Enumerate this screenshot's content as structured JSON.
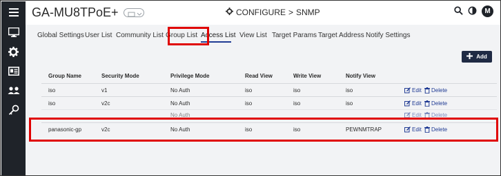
{
  "sidebar": {
    "items": [
      {
        "icon": "menu-icon"
      },
      {
        "icon": "monitor-icon"
      },
      {
        "icon": "gear-icon"
      },
      {
        "icon": "id-card-icon"
      },
      {
        "icon": "users-icon"
      },
      {
        "icon": "key-icon"
      }
    ]
  },
  "header": {
    "device_name": "GA-MU8TPoE+",
    "section": "CONFIGURE",
    "separator": ">",
    "page": "SNMP",
    "avatar_letter": "M"
  },
  "tabs": [
    {
      "label": "Global Settings"
    },
    {
      "label": "User List"
    },
    {
      "label": "Community List"
    },
    {
      "label": "Group List"
    },
    {
      "label": "Access List"
    },
    {
      "label": "View List"
    },
    {
      "label": "Target Params"
    },
    {
      "label": "Target Address"
    },
    {
      "label": "Notify Settings"
    }
  ],
  "active_tab": "Access List",
  "add_button": {
    "label": "Add"
  },
  "table": {
    "columns": [
      "Group Name",
      "Security Mode",
      "Privilege Mode",
      "Read View",
      "Write View",
      "Notify View"
    ],
    "edit_label": "Edit",
    "delete_label": "Delete",
    "rows": [
      {
        "group": "iso",
        "security": "v1",
        "privilege": "No Auth",
        "read": "iso",
        "write": "iso",
        "notify": "iso"
      },
      {
        "group": "iso",
        "security": "v2c",
        "privilege": "No Auth",
        "read": "iso",
        "write": "iso",
        "notify": "iso"
      },
      {
        "group": "",
        "security": "",
        "privilege": "No Auth",
        "read": "",
        "write": "",
        "notify": ""
      },
      {
        "group": "panasonic-gp",
        "security": "v2c",
        "privilege": "No Auth",
        "read": "iso",
        "write": "iso",
        "notify": "PEWNMTRAP"
      }
    ]
  },
  "colors": {
    "sidebar": "#1f2329",
    "accent": "#1f3a93",
    "highlight": "#e00000"
  }
}
